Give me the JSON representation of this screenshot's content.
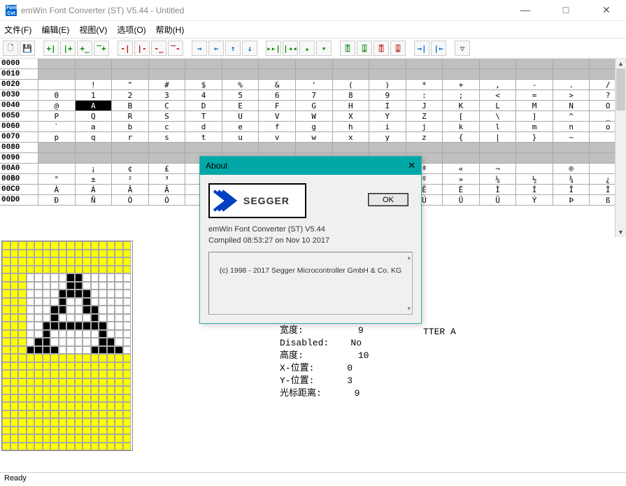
{
  "window": {
    "title": "emWin Font Converter (ST) V5.44 - Untitled",
    "minimize": "—",
    "maximize": "□",
    "close": "✕"
  },
  "menu": {
    "file": "文件(F)",
    "edit": "编辑(E)",
    "view": "视图(V)",
    "options": "选项(O)",
    "help": "帮助(H)"
  },
  "grid": {
    "rows": [
      {
        "addr": "0000",
        "shaded": true,
        "cells": [
          "",
          "",
          "",
          "",
          "",
          "",
          "",
          "",
          "",
          "",
          "",
          "",
          "",
          "",
          "",
          ""
        ]
      },
      {
        "addr": "0010",
        "shaded": true,
        "cells": [
          "",
          "",
          "",
          "",
          "",
          "",
          "",
          "",
          "",
          "",
          "",
          "",
          "",
          "",
          "",
          ""
        ]
      },
      {
        "addr": "0020",
        "shaded": false,
        "cells": [
          "",
          "!",
          "\"",
          "#",
          "$",
          "%",
          "&",
          "'",
          "(",
          ")",
          "*",
          "+",
          ",",
          "-",
          ".",
          "/"
        ]
      },
      {
        "addr": "0030",
        "shaded": false,
        "cells": [
          "0",
          "1",
          "2",
          "3",
          "4",
          "5",
          "6",
          "7",
          "8",
          "9",
          ":",
          ";",
          "<",
          "=",
          ">",
          "?"
        ]
      },
      {
        "addr": "0040",
        "shaded": false,
        "cells": [
          "@",
          "A",
          "B",
          "C",
          "D",
          "E",
          "F",
          "G",
          "H",
          "I",
          "J",
          "K",
          "L",
          "M",
          "N",
          "O"
        ],
        "selected": 1
      },
      {
        "addr": "0050",
        "shaded": false,
        "cells": [
          "P",
          "Q",
          "R",
          "S",
          "T",
          "U",
          "V",
          "W",
          "X",
          "Y",
          "Z",
          "[",
          "\\",
          "]",
          "^",
          "_"
        ]
      },
      {
        "addr": "0060",
        "shaded": false,
        "cells": [
          "`",
          "a",
          "b",
          "c",
          "d",
          "e",
          "f",
          "g",
          "h",
          "i",
          "j",
          "k",
          "l",
          "m",
          "n",
          "o"
        ]
      },
      {
        "addr": "0070",
        "shaded": false,
        "cells": [
          "p",
          "q",
          "r",
          "s",
          "t",
          "u",
          "v",
          "w",
          "x",
          "y",
          "z",
          "{",
          "|",
          "}",
          "~",
          ""
        ]
      },
      {
        "addr": "0080",
        "shaded": true,
        "cells": [
          "",
          "",
          "",
          "",
          "",
          "",
          "",
          "",
          "",
          "",
          "",
          "",
          "",
          "",
          "",
          ""
        ]
      },
      {
        "addr": "0090",
        "shaded": true,
        "cells": [
          "",
          "",
          "",
          "",
          "",
          "",
          "",
          "",
          "",
          "",
          "",
          "",
          "",
          "",
          "",
          ""
        ]
      },
      {
        "addr": "00A0",
        "shaded": false,
        "cells": [
          "",
          "¡",
          "¢",
          "£",
          "",
          "",
          "",
          "",
          "",
          "",
          "ª",
          "«",
          "¬",
          "",
          "®",
          ""
        ]
      },
      {
        "addr": "00B0",
        "shaded": false,
        "cells": [
          "°",
          "±",
          "²",
          "³",
          "",
          "",
          "",
          "",
          "",
          "",
          "º",
          "»",
          "¼",
          "½",
          "¾",
          "¿"
        ]
      },
      {
        "addr": "00C0",
        "shaded": false,
        "cells": [
          "À",
          "Á",
          "Â",
          "Ã",
          "",
          "",
          "",
          "",
          "",
          "",
          "Ê",
          "Ë",
          "Ì",
          "Í",
          "Î",
          "Ï"
        ]
      },
      {
        "addr": "00D0",
        "shaded": false,
        "cells": [
          "Ð",
          "Ñ",
          "Ò",
          "Ó",
          "",
          "",
          "",
          "",
          "",
          "",
          "Ú",
          "Û",
          "Ü",
          "Ý",
          "Þ",
          "ß"
        ]
      }
    ]
  },
  "glyph": {
    "pixels": [
      "0000000000000000",
      "0000000000000000",
      "0000000000000000",
      "0000000000000000",
      "0000000011000000",
      "0000000011000000",
      "0000000111100000",
      "0000000100100000",
      "0000001100110000",
      "0000001000010000",
      "0000011111111000",
      "0000010000001000",
      "0000110000001100",
      "0001111000011110",
      "0000000000000000",
      "0000000000000000",
      "0000000000000000",
      "0000000000000000",
      "0000000000000000",
      "0000000000000000",
      "0000000000000000",
      "0000000000000000",
      "0000000000000000",
      "0000000000000000",
      "0000000000000000",
      "0000000000000000"
    ],
    "yellowRowsStart": 0,
    "yellowRowsEnd": 3,
    "yellowRowsStart2": 14,
    "bgColStart": 0,
    "bgColEnd": 2
  },
  "props": {
    "visible_tail": "TTER A",
    "width_l": "宽度:",
    "width_v": "9",
    "dis_l": "Disabled:",
    "dis_v": "No",
    "height_l": "高度:",
    "height_v": "10",
    "x_l": "X-位置:",
    "x_v": "0",
    "y_l": "Y-位置:",
    "y_v": "3",
    "cur_l": "光标距离:",
    "cur_v": "9"
  },
  "about": {
    "title": "About",
    "logo_text": "SEGGER",
    "line1": "emWin Font Converter (ST) V5.44",
    "line2": "Compiled 08:53:27 on Nov 10 2017",
    "copyright": "(c) 1998 - 2017 Segger Microcontroller GmbH & Co. KG",
    "ok": "OK",
    "close": "✕"
  },
  "status": "Ready"
}
